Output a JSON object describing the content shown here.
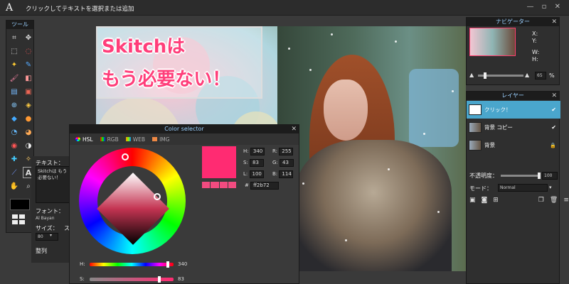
{
  "app": {
    "logo": "A",
    "status": "クリックしてテキストを選択または追加",
    "window_controls": "— ▫ ✕"
  },
  "tools_panel": {
    "title": "ツール",
    "tools": [
      "crop-icon",
      "move-icon",
      "marquee-icon",
      "lasso-icon",
      "wand-icon",
      "pencil-icon",
      "brush-icon",
      "eraser-icon",
      "fill-icon",
      "gradient-icon",
      "stamp-icon",
      "color-replace-icon",
      "drawing-icon",
      "blur-icon",
      "sponge-icon",
      "dodge-icon",
      "burn-icon",
      "redeye-icon",
      "spot-heal-icon",
      "bloat-icon",
      "pinch-icon",
      "hand-icon",
      "picker-icon",
      "text-icon",
      "zoom-icon",
      "zoom2-icon"
    ]
  },
  "text_options": {
    "label_text": "テキスト：",
    "text_value": "Skitchは もう必要ない！",
    "label_font": "フォント：",
    "font_value": "Al Bayan",
    "label_size": "サイズ：",
    "size_value": "80",
    "size_unit": "ス",
    "label_align": "整列"
  },
  "canvas": {
    "callout_line1": "Skitchは",
    "callout_line2": "もう必要ない！"
  },
  "color_selector": {
    "title": "Color selector",
    "tabs": [
      {
        "label": "HSL",
        "icon": "hsl-icon",
        "active": true
      },
      {
        "label": "RGB",
        "icon": "rgb-icon",
        "active": false
      },
      {
        "label": "WEB",
        "icon": "web-icon",
        "active": false
      },
      {
        "label": "IMG",
        "icon": "img-icon",
        "active": false
      }
    ],
    "h_label": "H:",
    "h_value": "340",
    "s_label": "S:",
    "s_value": "83",
    "l_label": "L:",
    "l_value": "100",
    "r_label": "R:",
    "r_value": "255",
    "g_label": "G:",
    "g_value": "43",
    "b_label": "B:",
    "b_value": "114",
    "hex_label": "#",
    "hex_value": "ff2b72",
    "slider_h_label": "H:",
    "slider_h_value": "340",
    "slider_s_label": "S:",
    "slider_s_value": "83",
    "selected_color": "#ff2b72"
  },
  "navigator": {
    "title": "ナビゲーター",
    "x_label": "X:",
    "y_label": "Y:",
    "w_label": "W:",
    "h_label": "H:",
    "zoom_value": "65",
    "zoom_unit": "%"
  },
  "layers": {
    "title": "レイヤー",
    "items": [
      {
        "name": "クリック！",
        "selected": true,
        "flag": "✔"
      },
      {
        "name": "背景 コピー",
        "selected": false,
        "flag": "✔"
      },
      {
        "name": "背景",
        "selected": false,
        "flag": "🔒"
      }
    ],
    "opacity_label": "不透明度：",
    "opacity_value": "100",
    "mode_label": "モード：",
    "mode_value": "Normal"
  }
}
